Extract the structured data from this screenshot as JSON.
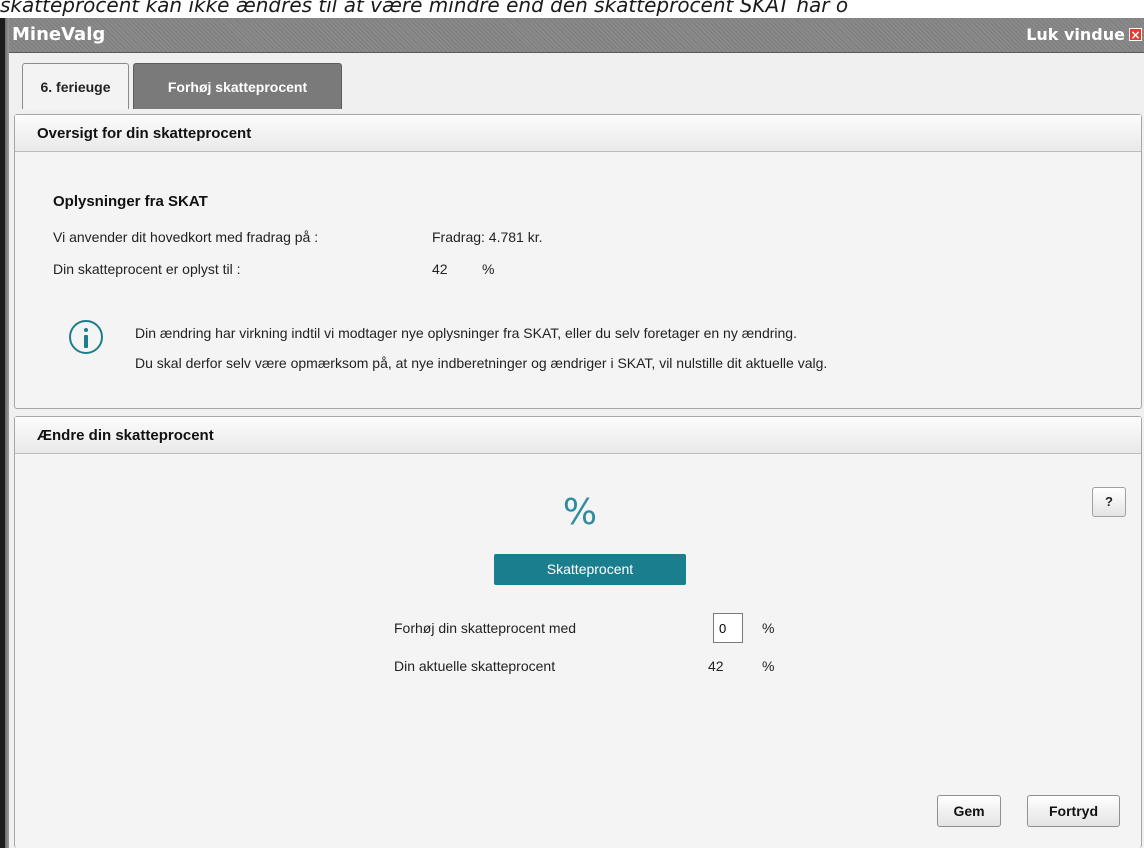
{
  "top_text": "skatteprocent kan ikke ændres til at være mindre end den skatteprocent SKAT har o",
  "window": {
    "title": "MineValg",
    "close_label": "Luk vindue",
    "close_glyph": "×"
  },
  "tabs": [
    {
      "label": "6. ferieuge",
      "active": false
    },
    {
      "label": "Forhøj skatteprocent",
      "active": true
    }
  ],
  "overview": {
    "header": "Oversigt for din skatteprocent",
    "section_title": "Oplysninger fra SKAT",
    "rows": [
      {
        "label": "Vi anvender dit hovedkort med fradrag på :",
        "value": "Fradrag: 4.781 kr.",
        "unit": ""
      },
      {
        "label": "Din skatteprocent er oplyst til :",
        "value": "42",
        "unit": "%"
      }
    ],
    "info_lines": [
      "Din ændring har virkning indtil vi modtager nye oplysninger fra SKAT, eller du selv foretager en ny ændring.",
      "Du skal derfor selv være opmærksom på, at nye indberetninger og ændriger i SKAT, vil nulstille dit aktuelle valg."
    ]
  },
  "change": {
    "header": "Ændre din skatteprocent",
    "help_label": "?",
    "icon_glyph": "%",
    "button_label": "Skatteprocent",
    "increase_label": "Forhøj din skatteprocent med",
    "increase_value": "0",
    "increase_unit": "%",
    "current_label": "Din aktuelle skatteprocent",
    "current_value": "42",
    "current_unit": "%"
  },
  "actions": {
    "save_label": "Gem",
    "cancel_label": "Fortryd"
  },
  "colors": {
    "accent": "#1b7e8e",
    "titlebar": "#808080",
    "close": "#e53b2f"
  }
}
